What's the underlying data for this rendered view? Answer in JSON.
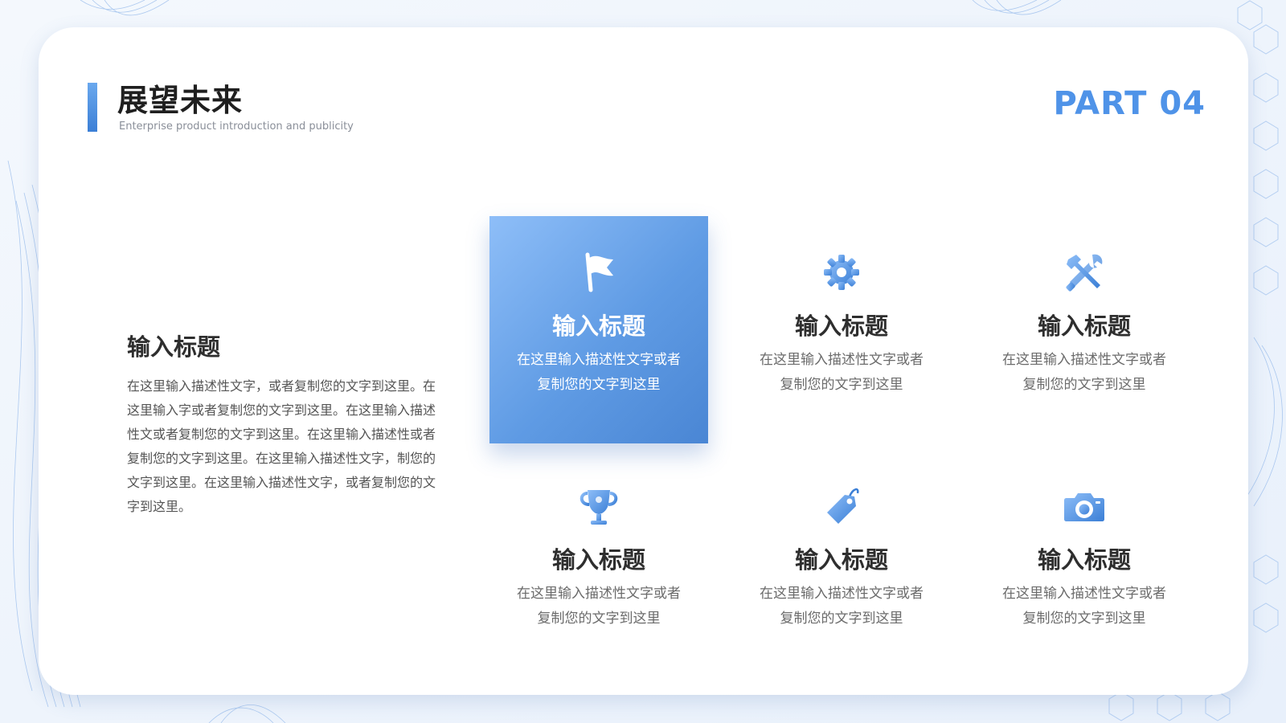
{
  "header": {
    "title": "展望未来",
    "subtitle": "Enterprise product introduction and publicity",
    "part": "PART 04"
  },
  "intro": {
    "title": "输入标题",
    "text": "在这里输入描述性文字，或者复制您的文字到这里。在这里输入字或者复制您的文字到这里。在这里输入描述性文或者复制您的文字到这里。在这里输入描述性或者复制您的文字到这里。在这里输入描述性文字，制您的文字到这里。在这里输入描述性文字，或者复制您的文字到这里。"
  },
  "features": [
    {
      "icon": "flag-icon",
      "title": "输入标题",
      "text": "在这里输入描述性文字或者复制您的文字到这里",
      "active": true
    },
    {
      "icon": "gear-icon",
      "title": "输入标题",
      "text": "在这里输入描述性文字或者复制您的文字到这里",
      "active": false
    },
    {
      "icon": "tools-icon",
      "title": "输入标题",
      "text": "在这里输入描述性文字或者复制您的文字到这里",
      "active": false
    },
    {
      "icon": "trophy-icon",
      "title": "输入标题",
      "text": "在这里输入描述性文字或者复制您的文字到这里",
      "active": false
    },
    {
      "icon": "tag-icon",
      "title": "输入标题",
      "text": "在这里输入描述性文字或者复制您的文字到这里",
      "active": false
    },
    {
      "icon": "camera-icon",
      "title": "输入标题",
      "text": "在这里输入描述性文字或者复制您的文字到这里",
      "active": false
    }
  ],
  "colors": {
    "accent": "#4f93e8",
    "active_card_start": "#8ebef8",
    "active_card_end": "#4a86d4",
    "title_text": "#2e2e2e",
    "body_text": "#6b6b6b"
  }
}
